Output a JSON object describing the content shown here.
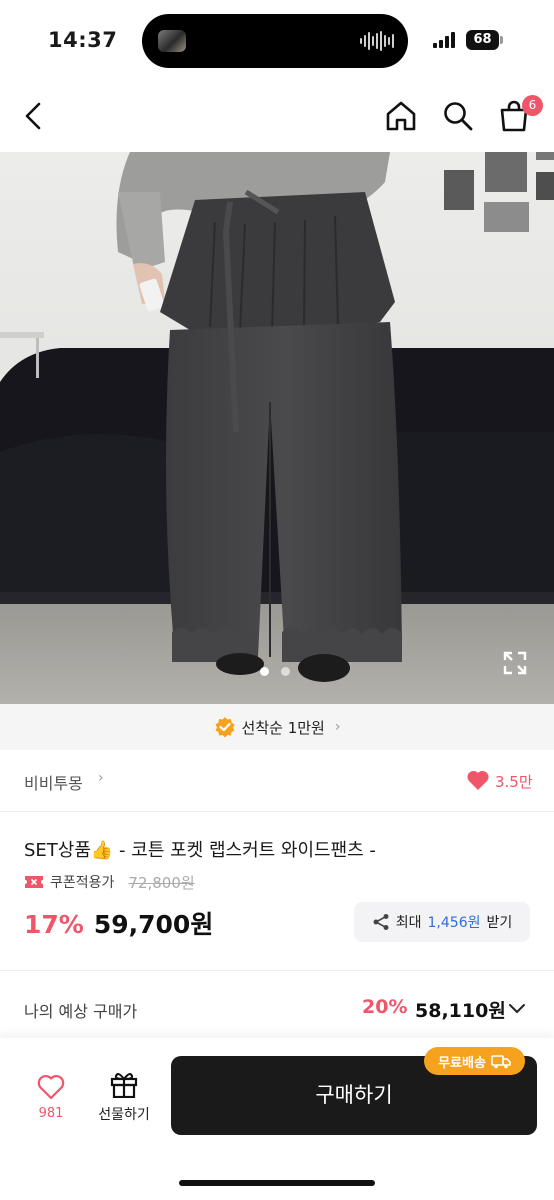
{
  "status_bar": {
    "time": "14:37",
    "battery": "68"
  },
  "nav": {
    "cart_count": "6"
  },
  "gallery": {
    "current_slide": 1,
    "total_slides": 2
  },
  "promo": {
    "text": "선착순 1만원",
    "chevron": "›"
  },
  "brand": {
    "name": "비비투몽",
    "chevron": "›",
    "likes": "3.5만"
  },
  "product": {
    "title": "SET상품👍 - 코튼 포켓 랩스커트 와이드팬츠  -",
    "coupon_label": "쿠폰적용가",
    "original_price": "72,800원",
    "discount": "17%",
    "price": "59,700원",
    "reward": {
      "prefix": "최대",
      "amount": "1,456원",
      "suffix": "받기"
    }
  },
  "estimate": {
    "label": "나의 예상 구매가",
    "discount": "20%",
    "price": "58,110원"
  },
  "bottom_bar": {
    "wish_count": "981",
    "gift_label": "선물하기",
    "buy_label": "구매하기",
    "shipping_badge": "무료배송"
  },
  "colors": {
    "accent": "#f0566a",
    "link_blue": "#2f6fd6",
    "badge_orange": "#f6a21e",
    "dark": "#1a1a1a"
  },
  "icons": [
    "back-arrow-icon",
    "home-icon",
    "search-icon",
    "cart-icon",
    "expand-icon",
    "promo-check-icon",
    "heart-icon",
    "coupon-icon",
    "share-icon",
    "chevron-down-icon",
    "gift-icon",
    "truck-icon"
  ]
}
